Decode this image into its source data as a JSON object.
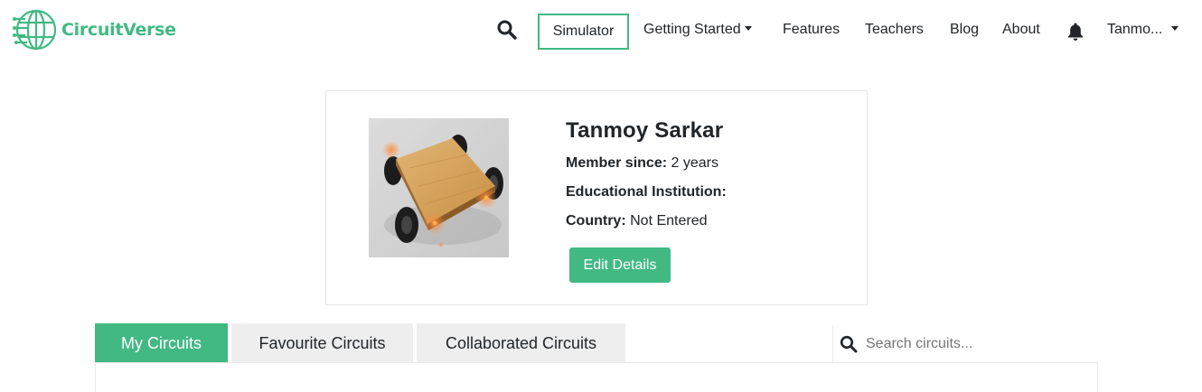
{
  "brand": {
    "name": "CircuitVerse",
    "color": "#42b983",
    "icon": "circuitverse-globe-logo"
  },
  "nav": {
    "search_icon": "search-icon",
    "simulator": "Simulator",
    "getting_started": "Getting Started",
    "features": "Features",
    "teachers": "Teachers",
    "blog": "Blog",
    "about": "About",
    "notification_icon": "bell-icon",
    "user": "Tanmo..."
  },
  "profile": {
    "name": "Tanmoy Sarkar",
    "member_since_label": "Member since:",
    "member_since_value": "2 years",
    "institution_label": "Educational Institution:",
    "institution_value": "",
    "country_label": "Country:",
    "country_value": "Not Entered",
    "edit_button": "Edit Details",
    "avatar": "photo of wooden robot car chassis with orange LEDs"
  },
  "tabs": [
    {
      "label": "My Circuits",
      "active": true
    },
    {
      "label": "Favourite Circuits",
      "active": false
    },
    {
      "label": "Collaborated Circuits",
      "active": false
    }
  ],
  "search": {
    "placeholder": "Search circuits...",
    "value": "",
    "icon": "search-icon"
  },
  "colors": {
    "accent": "#42b983",
    "tab_inactive": "#eeeeee",
    "text": "#212529"
  }
}
